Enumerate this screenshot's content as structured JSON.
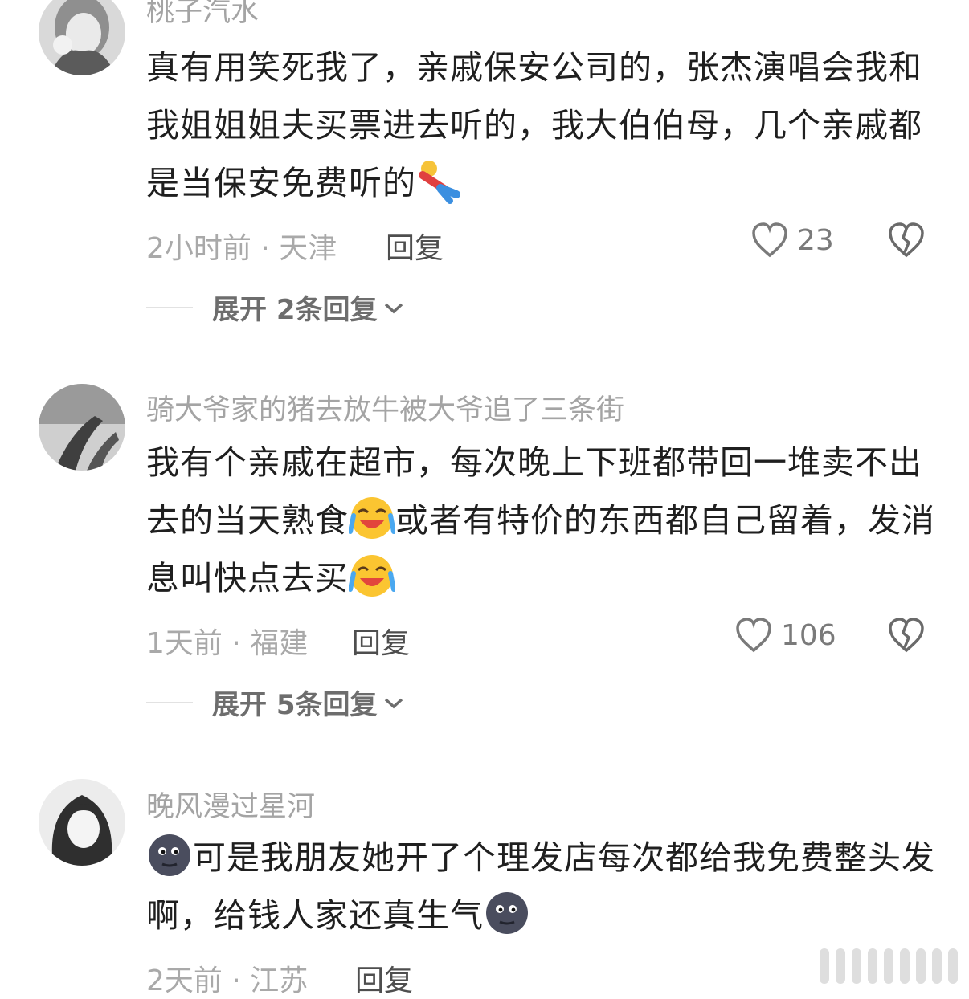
{
  "comments": [
    {
      "username": "桃子汽水",
      "text_parts": [
        "真有用笑死我了，亲戚保安公司的，张杰演唱会我和我姐姐姐夫买票进去听的，我大伯伯母，几个亲戚都是当保安免费听的"
      ],
      "emoji_after": "lying-figure-emoji",
      "time_location": "2小时前 · 天津",
      "reply_label": "回复",
      "like_count": "23",
      "expand_label": "展开 2条回复"
    },
    {
      "username": "骑大爷家的猪去放牛被大爷追了三条街",
      "text_parts": [
        "我有个亲戚在超市，每次晚上下班都带回一堆卖不出去的当天熟食",
        "或者有特价的东西都自己留着，发消息叫快点去买"
      ],
      "emoji_after": "crying-laughing-emoji",
      "time_location": "1天前 · 福建",
      "reply_label": "回复",
      "like_count": "106",
      "expand_label": "展开 5条回复"
    },
    {
      "username": "晚风漫过星河",
      "text_parts": [
        "可是我朋友她开了个理发店每次都给我免费整头发啊，给钱人家还真生气"
      ],
      "emoji_after": "dark-moon-face-emoji",
      "time_location": "2天前 · 江苏",
      "reply_label": "回复"
    }
  ],
  "colors": {
    "username": "#a4a4a4",
    "text": "#1f1f1f",
    "meta": "#a9a9a9",
    "expand": "#6d6d6d"
  }
}
